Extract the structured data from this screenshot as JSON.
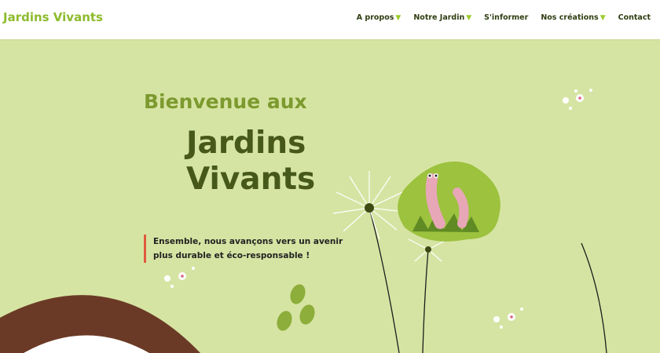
{
  "header": {
    "brand": "Jardins Vivants",
    "nav": [
      {
        "label": "A propos",
        "dropdown": true
      },
      {
        "label": "Notre Jardin",
        "dropdown": true
      },
      {
        "label": "S'informer",
        "dropdown": false
      },
      {
        "label": "Nos créations",
        "dropdown": true
      },
      {
        "label": "Contact",
        "dropdown": false
      }
    ],
    "caret": "▼"
  },
  "hero": {
    "welcome": "Bienvenue aux",
    "title_line1": "Jardins",
    "title_line2": "Vivants",
    "quote": "Ensemble, nous avançons vers un avenir plus durable et éco-responsable !"
  },
  "colors": {
    "background": "#d6e4a3",
    "brand": "#8dbb2c",
    "title": "#46581a",
    "accent_bar": "#e05a3d",
    "soil": "#6b3a26"
  },
  "icons": [
    "worm-illustration",
    "dandelion-icon",
    "flower-icon",
    "leaf-icon"
  ]
}
